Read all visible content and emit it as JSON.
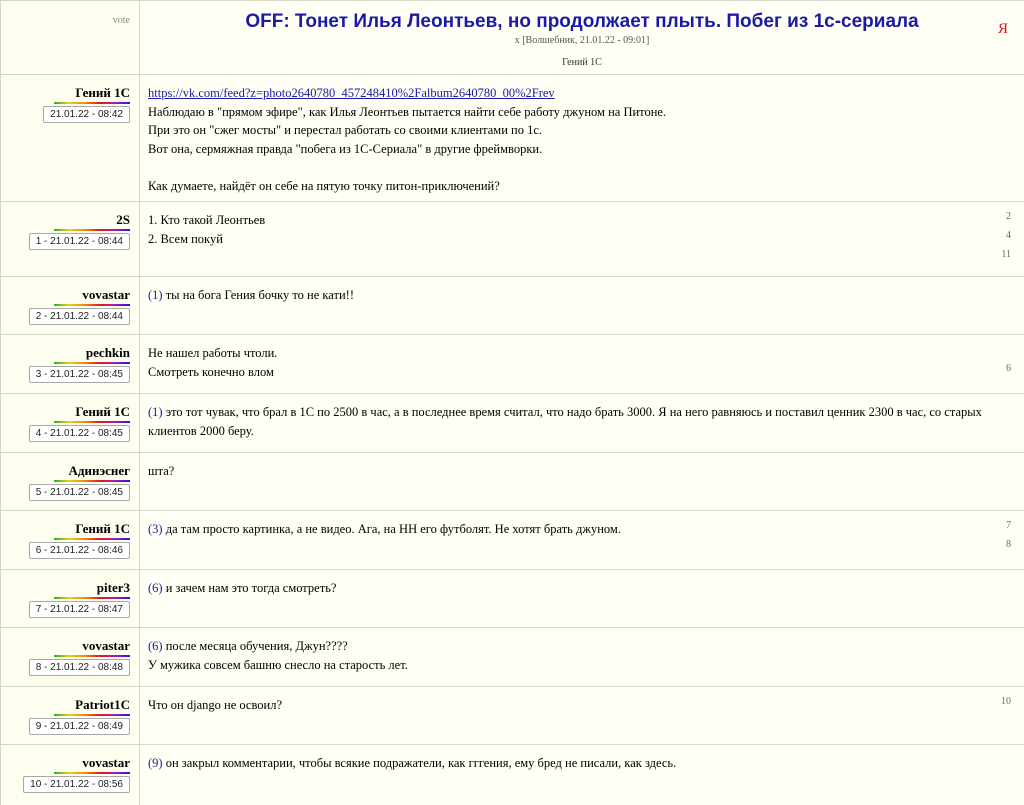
{
  "header": {
    "vote_label": "vote",
    "title": "OFF: Тонет Илья Леонтьев, но продолжает плыть. Побег из 1с-сериала",
    "subtitle": "x [Волшебник, 21.01.22 - 09:01]",
    "category": "Гений 1С",
    "ya_label": "Я"
  },
  "posts": [
    {
      "user": "Гений 1С",
      "date": "21.01.22 - 08:42",
      "height": 127,
      "lines": [
        {
          "text": "https://vk.com/feed?z=photo2640780_457248410%2Falbum2640780_00%2Frev",
          "link": true
        },
        {
          "text": "Наблюдаю в \"прямом эфире\", как Илья Леонтьев пытается найти себе работу джуном на Питоне."
        },
        {
          "text": "При это он \"сжег мосты\" и перестал работать со своими клиентами по 1с."
        },
        {
          "text": "Вот она, сермяжная правда \"побега из 1С-Сериала\" в другие фреймворки."
        },
        {
          "text": ""
        },
        {
          "text": "Как думаете, найдёт он себе на пятую точку питон-приключений?"
        }
      ],
      "counts": []
    },
    {
      "user": "2S",
      "date": "1 - 21.01.22 - 08:44",
      "height": 75,
      "lines": [
        {
          "text": "1. Кто такой Леонтьев"
        },
        {
          "text": "2. Всем покуй"
        }
      ],
      "counts": [
        "2",
        "4",
        "11"
      ]
    },
    {
      "user": "vovastar",
      "date": "2 - 21.01.22 - 08:44",
      "height": 58,
      "lines": [
        {
          "ref": "(1)",
          "text": " ты на бога Гения бочку то не кати!!"
        }
      ],
      "counts": []
    },
    {
      "user": "pechkin",
      "date": "3 - 21.01.22 - 08:45",
      "height": 59,
      "lines": [
        {
          "text": "Не нашел работы чтоли."
        },
        {
          "text": "Смотреть конечно влом"
        }
      ],
      "counts": [
        "",
        "6"
      ]
    },
    {
      "user": "Гений 1С",
      "date": "4 - 21.01.22 - 08:45",
      "height": 59,
      "lines": [
        {
          "ref": "(1)",
          "text": " это тот чувак, что брал в 1С по 2500 в час, а в последнее время считал, что надо брать 3000. Я на него равняюсь и поставил ценник 2300 в час, со старых клиентов 2000 беру."
        }
      ],
      "counts": []
    },
    {
      "user": "Адинэснег",
      "date": "5 - 21.01.22 - 08:45",
      "height": 58,
      "lines": [
        {
          "text": "шта?"
        }
      ],
      "counts": []
    },
    {
      "user": "Гений 1С",
      "date": "6 - 21.01.22 - 08:46",
      "height": 59,
      "lines": [
        {
          "ref": "(3)",
          "text": " да там просто картинка, а не видео. Ага, на НН его футболят. Не хотят брать джуном."
        }
      ],
      "counts": [
        "7",
        "8"
      ]
    },
    {
      "user": "piter3",
      "date": "7 - 21.01.22 - 08:47",
      "height": 58,
      "lines": [
        {
          "ref": "(6)",
          "text": " и зачем нам это тогда смотреть?"
        }
      ],
      "counts": []
    },
    {
      "user": "vovastar",
      "date": "8 - 21.01.22 - 08:48",
      "height": 59,
      "lines": [
        {
          "ref": "(6)",
          "text": " после месяца обучения, Джун????"
        },
        {
          "text": "У мужика совсем башню снесло на старость лет."
        }
      ],
      "counts": []
    },
    {
      "user": "Patriot1C",
      "date": "9 - 21.01.22 - 08:49",
      "height": 58,
      "lines": [
        {
          "text": "Что он django не освоил?"
        }
      ],
      "counts": [
        "10"
      ]
    },
    {
      "user": "vovastar",
      "date": "10 - 21.01.22 - 08:56",
      "height": 62,
      "lines": [
        {
          "ref": "(9)",
          "text": " он закрыл комментарии, чтобы всякие подражатели, как гггения, ему бред не писали, как здесь."
        }
      ],
      "counts": []
    }
  ]
}
